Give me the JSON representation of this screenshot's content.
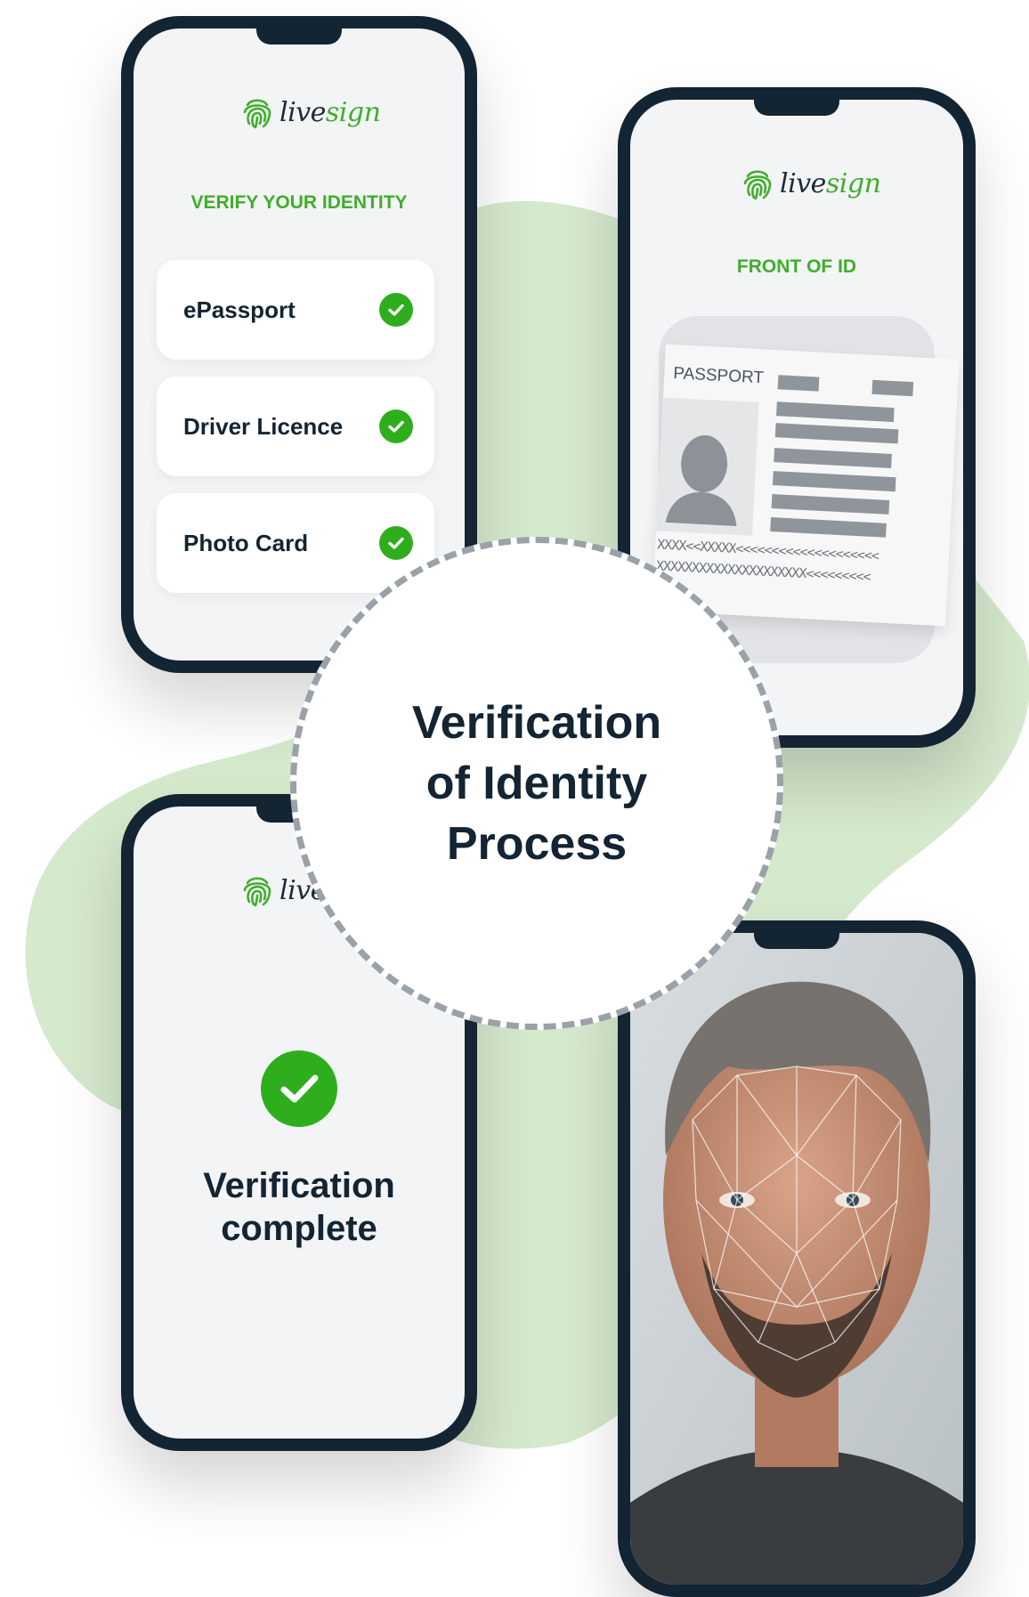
{
  "brand": {
    "name_part1": "live",
    "name_part2": "sign",
    "accent_color": "#3fae29",
    "dark_color": "#132433",
    "blob_color": "#d5e9cd"
  },
  "screen_select": {
    "heading": "VERIFY YOUR IDENTITY",
    "options": [
      {
        "label": "ePassport",
        "icon": "check-circle-icon"
      },
      {
        "label": "Driver Licence",
        "icon": "check-circle-icon"
      },
      {
        "label": "Photo Card",
        "icon": "check-circle-icon"
      }
    ]
  },
  "screen_id": {
    "heading": "FRONT OF ID",
    "document_label": "PASSPORT",
    "mrz_line_1": "XXXX<<XXXXX<<<<<<<<<<<<<<<<<<<<",
    "mrz_line_2": "XXXXXXXXXXXXXXXXXXXXX<<<<<<<<<"
  },
  "screen_complete": {
    "icon": "check-circle-icon",
    "message_line_1": "Verification",
    "message_line_2": "complete"
  },
  "screen_face": {
    "description_icon": "face-scan-icon"
  },
  "center": {
    "title_line_1": "Verification",
    "title_line_2": "of Identity",
    "title_line_3": "Process"
  }
}
